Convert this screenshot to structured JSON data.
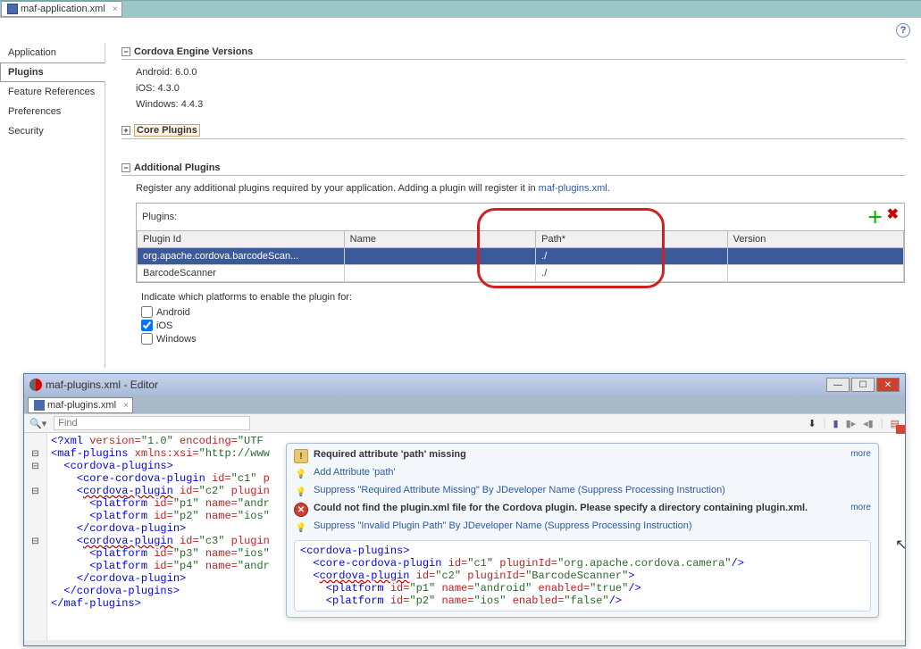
{
  "topTab": {
    "label": "maf-application.xml"
  },
  "sidenav": {
    "items": [
      "Application",
      "Plugins",
      "Feature References",
      "Preferences",
      "Security"
    ],
    "activeIndex": 1
  },
  "sections": {
    "cev": {
      "title": "Cordova Engine Versions",
      "lines": [
        "Android: 6.0.0",
        "iOS: 4.3.0",
        "Windows: 4.4.3"
      ]
    },
    "core": {
      "title": "Core Plugins"
    },
    "addl": {
      "title": "Additional Plugins",
      "desc_pre": "Register any additional plugins required by your application. Adding a plugin will register it in ",
      "desc_link": "maf-plugins.xml",
      "desc_post": ".",
      "plugins_label": "Plugins:",
      "headers": [
        "Plugin Id",
        "Name",
        "Path*",
        "Version"
      ],
      "rows": [
        {
          "id": "org.apache.cordova.barcodeScan...",
          "name": "",
          "path": "./",
          "version": ""
        },
        {
          "id": "BarcodeScanner",
          "name": "",
          "path": "./",
          "version": ""
        }
      ],
      "platforms_label": "Indicate which platforms to enable the plugin for:",
      "platforms": [
        {
          "label": "Android",
          "checked": false
        },
        {
          "label": "iOS",
          "checked": true
        },
        {
          "label": "Windows",
          "checked": false
        }
      ]
    }
  },
  "editor": {
    "title": "maf-plugins.xml - Editor",
    "tab": "maf-plugins.xml",
    "find_placeholder": "Find"
  },
  "hints": {
    "h1_title": "Required attribute 'path' missing",
    "h1_a": "Add Attribute 'path'",
    "h1_b": "Suppress \"Required Attribute Missing\" By JDeveloper Name (Suppress Processing Instruction)",
    "h2_title": "Could not find the plugin.xml file for the Cordova plugin.  Please specify a directory containing plugin.xml.",
    "h2_a": "Suppress \"Invalid Plugin Path\" By JDeveloper Name (Suppress Processing Instruction)",
    "more": "more"
  }
}
